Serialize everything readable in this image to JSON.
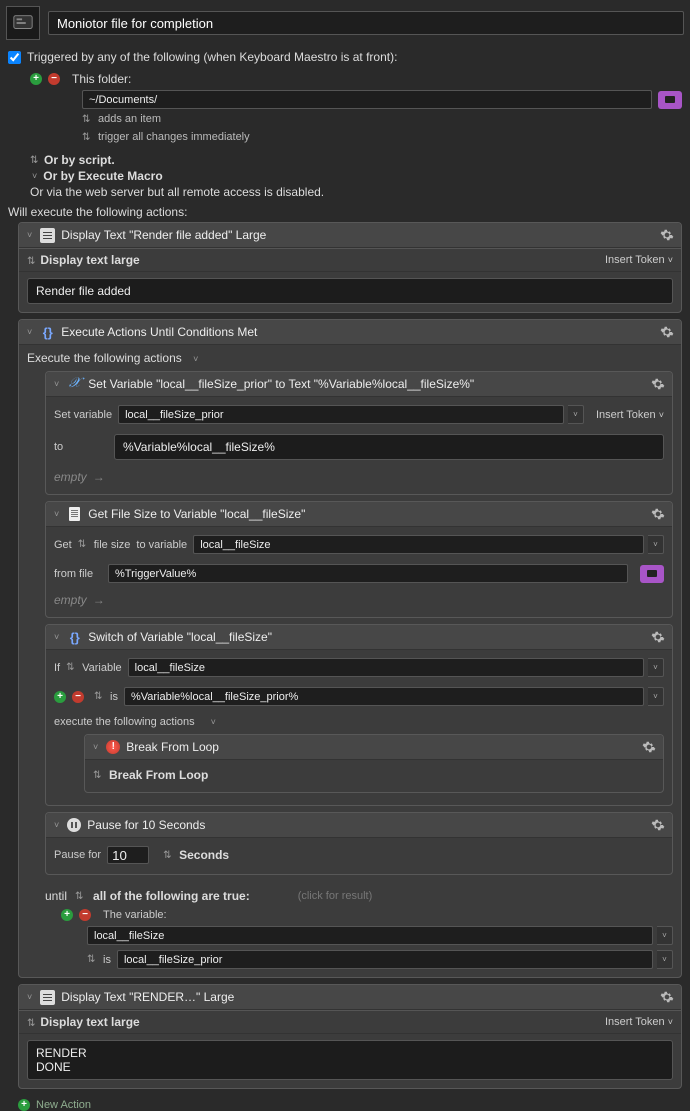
{
  "title": "Moniotor file for completion",
  "trigger": {
    "label": "Triggered by any of the following (when Keyboard Maestro is at front):",
    "folder_label": "This folder:",
    "folder_path": "~/Documents/",
    "adds_item": "adds an item",
    "trigger_changes": "trigger all changes immediately",
    "or_script": "Or by script.",
    "or_execute_macro": "Or by Execute Macro",
    "or_web": "Or via the web server but all remote access is disabled."
  },
  "will_execute": "Will execute the following actions:",
  "display1": {
    "title": "Display Text \"Render file added\" Large",
    "sub": "Display text large",
    "insert": "Insert Token",
    "text": "Render file added"
  },
  "loop": {
    "title": "Execute Actions Until Conditions Met",
    "exec_label": "Execute the following actions",
    "setvar": {
      "title": "Set Variable \"local__fileSize_prior\" to Text \"%Variable%local__fileSize%\"",
      "label": "Set variable",
      "var_name": "local__fileSize_prior",
      "insert": "Insert Token",
      "to_label": "to",
      "to_value": "%Variable%local__fileSize%",
      "empty": "empty"
    },
    "getsize": {
      "title": "Get File Size to Variable \"local__fileSize\"",
      "get_label": "Get",
      "file_size": "file size",
      "to_var_label": "to variable",
      "var_name": "local__fileSize",
      "from_label": "from file",
      "from_value": "%TriggerValue%",
      "empty": "empty"
    },
    "switch": {
      "title": "Switch of Variable \"local__fileSize\"",
      "if_label": "If",
      "variable_label": "Variable",
      "var_name": "local__fileSize",
      "is_label": "is",
      "is_value": "%Variable%local__fileSize_prior%",
      "exec_label": "execute the following actions",
      "break_title": "Break From Loop",
      "break_sub": "Break From Loop"
    },
    "pause": {
      "title": "Pause for 10 Seconds",
      "label": "Pause for",
      "value": "10",
      "unit": "Seconds"
    },
    "until_label": "until",
    "until_cond": "all of the following are true:",
    "click_result": "(click for result)",
    "the_variable": "The variable:",
    "var_field": "local__fileSize",
    "is_label2": "is",
    "var_field2": "local__fileSize_prior"
  },
  "display2": {
    "title": "Display Text \"RENDER…\" Large",
    "sub": "Display text large",
    "insert": "Insert Token",
    "text": "RENDER\nDONE"
  },
  "new_action": "New Action",
  "chev_down": "˅"
}
